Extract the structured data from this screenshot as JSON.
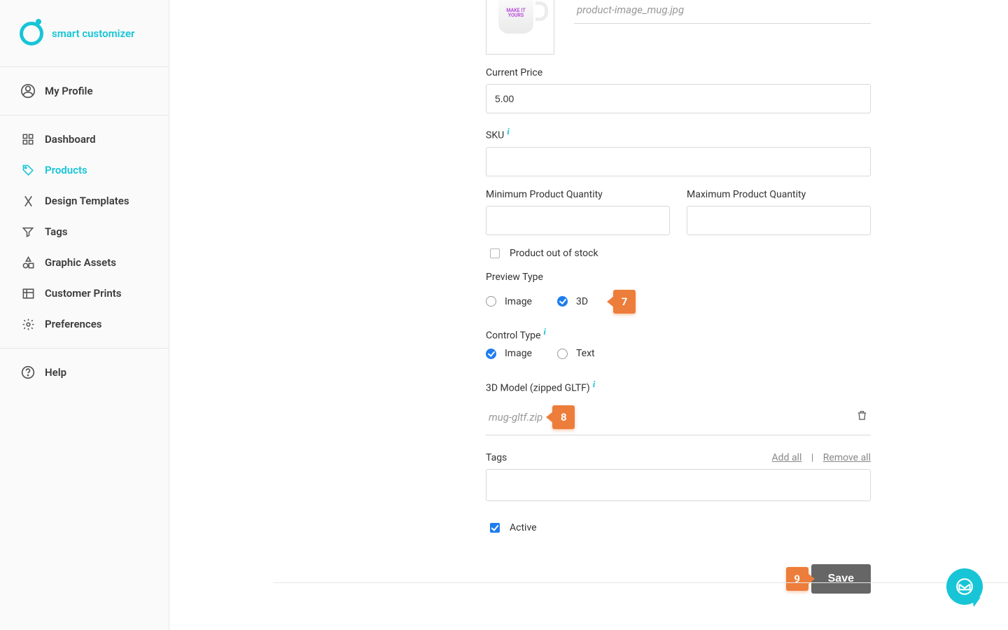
{
  "brand": {
    "name": "smart customizer"
  },
  "sidebar": {
    "profile": "My Profile",
    "items": [
      {
        "label": "Dashboard",
        "icon": "dashboard-icon"
      },
      {
        "label": "Products",
        "icon": "tag-icon"
      },
      {
        "label": "Design Templates",
        "icon": "tools-icon"
      },
      {
        "label": "Tags",
        "icon": "filter-icon"
      },
      {
        "label": "Graphic Assets",
        "icon": "shapes-icon"
      },
      {
        "label": "Customer Prints",
        "icon": "list-icon"
      },
      {
        "label": "Preferences",
        "icon": "gear-icon"
      }
    ],
    "help": "Help"
  },
  "form": {
    "thumb_text": "MAKE IT YOURS",
    "image_filename": "product-image_mug.jpg",
    "price_label": "Current Price",
    "price_value": "5.00",
    "sku_label": "SKU",
    "sku_value": "",
    "min_qty_label": "Minimum Product Quantity",
    "min_qty_value": "",
    "max_qty_label": "Maximum Product Quantity",
    "max_qty_value": "",
    "out_of_stock_label": "Product out of stock",
    "out_of_stock_checked": false,
    "preview_type_label": "Preview Type",
    "preview_options": {
      "image": "Image",
      "threeD": "3D"
    },
    "preview_selected": "3D",
    "control_type_label": "Control Type",
    "control_options": {
      "image": "Image",
      "text": "Text"
    },
    "control_selected": "Image",
    "model_label": "3D Model (zipped GLTF)",
    "model_filename": "mug-gltf.zip",
    "tags_label": "Tags",
    "tags_add_all": "Add all",
    "tags_remove_all": "Remove all",
    "active_label": "Active",
    "active_checked": true,
    "save_label": "Save"
  },
  "callouts": {
    "c7": "7",
    "c8": "8",
    "c9": "9"
  },
  "colors": {
    "accent": "#17c5d6",
    "callout": "#ed7d3a"
  }
}
